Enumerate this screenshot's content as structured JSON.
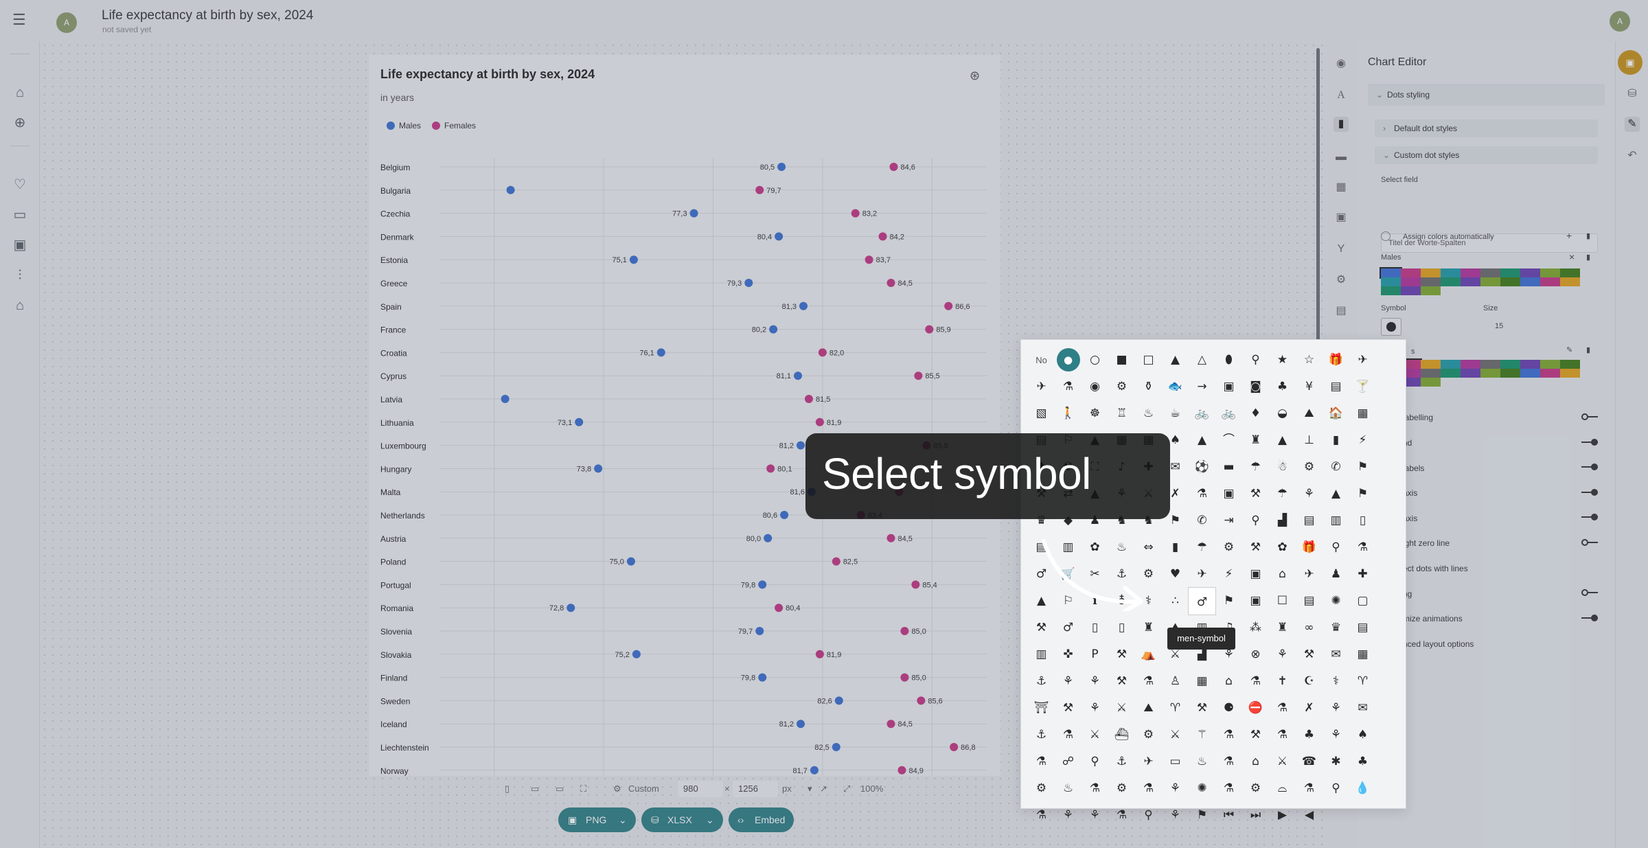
{
  "header": {
    "menu_icon": "hamburger-icon",
    "doc_avatar": "A",
    "doc_title": "Life expectancy at birth by sex, 2024",
    "doc_status": "not saved yet",
    "user_avatar": "A"
  },
  "left_rail": {
    "items": [
      "home-icon",
      "add-icon",
      "heart-icon",
      "folder-icon",
      "image-icon",
      "sliders-icon",
      "graduation-cap-icon"
    ]
  },
  "chart_data": {
    "type": "scatter",
    "title": "Life expectancy at birth by sex, 2024",
    "subtitle": "in years",
    "categories": [
      "Belgium",
      "Bulgaria",
      "Czechia",
      "Denmark",
      "Estonia",
      "Greece",
      "Spain",
      "France",
      "Croatia",
      "Cyprus",
      "Latvia",
      "Lithuania",
      "Luxembourg",
      "Hungary",
      "Malta",
      "Netherlands",
      "Austria",
      "Poland",
      "Portugal",
      "Romania",
      "Slovenia",
      "Slovakia",
      "Finland",
      "Sweden",
      "Iceland",
      "Liechtenstein",
      "Norway"
    ],
    "series": [
      {
        "name": "Males",
        "color": "#3a6fd0",
        "values": [
          80.5,
          70.6,
          77.3,
          80.4,
          75.1,
          79.3,
          81.3,
          80.2,
          76.1,
          81.1,
          70.4,
          73.1,
          81.2,
          73.8,
          81.6,
          80.6,
          80.0,
          75.0,
          79.8,
          72.8,
          79.7,
          75.2,
          79.8,
          82.6,
          81.2,
          82.5,
          81.7
        ]
      },
      {
        "name": "Females",
        "color": "#c43584",
        "values": [
          84.6,
          79.7,
          83.2,
          84.2,
          83.7,
          84.5,
          86.6,
          85.9,
          82.0,
          85.5,
          81.5,
          81.9,
          85.8,
          80.1,
          84.8,
          83.4,
          84.5,
          82.5,
          85.4,
          80.4,
          85.0,
          81.9,
          85.0,
          85.6,
          84.5,
          86.8,
          84.9
        ]
      }
    ],
    "labels": {
      "Males": [
        "80,5",
        "",
        "77,3",
        "80,4",
        "75,1",
        "79,3",
        "81,3",
        "80,2",
        "76,1",
        "81,1",
        "",
        "73,1",
        "81,2",
        "73,8",
        "81,6",
        "80,6",
        "80,0",
        "75,0",
        "79,8",
        "72,8",
        "79,7",
        "75,2",
        "79,8",
        "82,6",
        "81,2",
        "82,5",
        "81,7"
      ],
      "Females": [
        "84,6",
        "79,7",
        "83,2",
        "84,2",
        "83,7",
        "84,5",
        "86,6",
        "85,9",
        "82,0",
        "85,5",
        "81,5",
        "81,9",
        "85,8",
        "80,1",
        "",
        "83,4",
        "84,5",
        "82,5",
        "85,4",
        "80,4",
        "85,0",
        "81,9",
        "85,0",
        "85,6",
        "84,5",
        "86,8",
        "84,9"
      ]
    },
    "xlim": [
      68,
      88
    ],
    "grid": true,
    "legend_position": "top-left"
  },
  "chart_logo_icon": "datawrapper-logo-icon",
  "size_bar": {
    "preset": "Custom",
    "width": "980",
    "times": "×",
    "height": "1256",
    "unit": "px",
    "zoom": "100%"
  },
  "export": {
    "png": "PNG",
    "xlsx": "XLSX",
    "embed": "Embed"
  },
  "right_rail": [
    "eye-icon",
    "text-icon",
    "bar-chart-icon",
    "comment-icon",
    "table-icon",
    "preview-icon",
    "fork-icon",
    "gear-icon",
    "paint-roller-icon"
  ],
  "editor": {
    "title": "Chart Editor",
    "dots_styling": "Dots styling",
    "default_dot_styles": "Default dot styles",
    "custom_dot_styles": "Custom dot styles",
    "select_field_label": "Select field",
    "select_field_value": "Titel der Worte-Spalten",
    "assign_colors": "Assign colors automatically",
    "males_label": "Males",
    "symbol_label": "Symbol",
    "size_label": "Size",
    "size_value": "15",
    "females_label": "s",
    "options": [
      {
        "label": "labelling",
        "on": false
      },
      {
        "label": "nd",
        "on": true
      },
      {
        "label": "labels",
        "on": true
      },
      {
        "label": "axis",
        "on": true
      },
      {
        "label": "axis",
        "on": true
      },
      {
        "label": "ight zero line",
        "on": false
      },
      {
        "label": "ect dots with lines",
        "on": null
      },
      {
        "label": "ng",
        "on": false
      },
      {
        "label": "mize animations",
        "on": true
      },
      {
        "label": "nced layout options",
        "on": null
      }
    ],
    "palette_colors": [
      "#3b6fd4",
      "#c43584",
      "#e2a21b",
      "#1f9aa7",
      "#b2329b",
      "#6b6b6b",
      "#17926a",
      "#6a3fb1",
      "#7fa82c",
      "#3f7a17"
    ]
  },
  "far_rail": [
    "save-icon",
    "database-icon",
    "pencil-icon",
    "undo-icon"
  ],
  "symbol_picker": {
    "none_label": "No",
    "hovered_symbol": "men-symbol",
    "tooltip": "men-symbol",
    "symbols": [
      "●",
      "○",
      "■",
      "□",
      "▲",
      "△",
      "⬮",
      "⚲",
      "★",
      "☆",
      "🎁",
      "✈",
      "✈",
      "⚗",
      "◉",
      "⚙",
      "⚱",
      "🐟",
      "→",
      "▣",
      "◙",
      "♣",
      "¥",
      "▤",
      "🍸",
      "▧",
      "🚶",
      "☸",
      "♖",
      "♨",
      "☕",
      "🚲",
      "🚲",
      "♦",
      "◒",
      "⛰",
      "🏠",
      "▦",
      "▤",
      "⚐",
      "▲",
      "▦",
      "▦",
      "♠",
      "▲",
      "⌒",
      "♜",
      "▲",
      "⊥",
      "▮",
      "⚡",
      "♦",
      "☢",
      "⛶",
      "♪",
      "✚",
      "✉",
      "⚽",
      "▬",
      "☂",
      "☃",
      "⚙",
      "✆",
      "⚑",
      "⚒",
      "⇄",
      "▲",
      "⚘",
      "⚔",
      "✗",
      "⚗",
      "▣",
      "⚒",
      "☂",
      "⚘",
      "▲",
      "⚑",
      "♛",
      "◆",
      "♟",
      "♞",
      "♞",
      "⚑",
      "✆",
      "⇥",
      "⚲",
      "▟",
      "▤",
      "▥",
      "▯",
      "▤",
      "▥",
      "✿",
      "♨",
      "⇔",
      "▮",
      "☂",
      "⚙",
      "⚒",
      "✿",
      "🎁",
      "⚲",
      "⚗",
      "♂",
      "🛒",
      "✂",
      "⚓",
      "⚙",
      "♥",
      "✈",
      "⚡",
      "▣",
      "⌂",
      "✈",
      "♟",
      "✚",
      "▲",
      "⚐",
      "ℹ",
      "♁",
      "⚕",
      "∴",
      "▥",
      "⚑",
      "▣",
      "☐",
      "▤",
      "✺",
      "▢",
      "⚒",
      "♂",
      "▯",
      "▯",
      "♜",
      "⛰",
      "▥",
      "♫",
      "⁂",
      "♜",
      "∞",
      "♛",
      "▤",
      "▥",
      "✜",
      "P",
      "⚒",
      "⛺",
      "⚔",
      "▟",
      "⚘",
      "⊗",
      "⚘",
      "⚒",
      "✉",
      "▦",
      "⚓",
      "⚘",
      "⚘",
      "⚒",
      "⚗",
      "♙",
      "▦",
      "⌂",
      "⚗",
      "✝",
      "☪",
      "⚕",
      "♈",
      "⛩",
      "⚒",
      "⚘",
      "⚔",
      "⛰",
      "♈",
      "⚒",
      "⚈",
      "⛔",
      "⚗",
      "✗",
      "⚘",
      "✉",
      "⚓",
      "⚗",
      "⚔",
      "⛴",
      "⚙",
      "⚔",
      "⚚",
      "⚗",
      "⚒",
      "⚗",
      "♣",
      "⚘",
      "♠",
      "⚗",
      "☍",
      "⚲",
      "⚓",
      "✈",
      "▭",
      "♨",
      "⚗",
      "⌂",
      "⚔",
      "☎",
      "✱",
      "♣",
      "⚙",
      "♨",
      "⚗",
      "⚙",
      "⚗",
      "⚘",
      "✺",
      "⚗",
      "⚙",
      "⌓",
      "⚗",
      "⚲",
      "💧",
      "⚗",
      "⚘",
      "⚘",
      "⚗",
      "⚲",
      "⚘",
      "⚑",
      "⏮",
      "⏭",
      "▶",
      "◀"
    ]
  },
  "callout": {
    "text": "Select symbol"
  }
}
